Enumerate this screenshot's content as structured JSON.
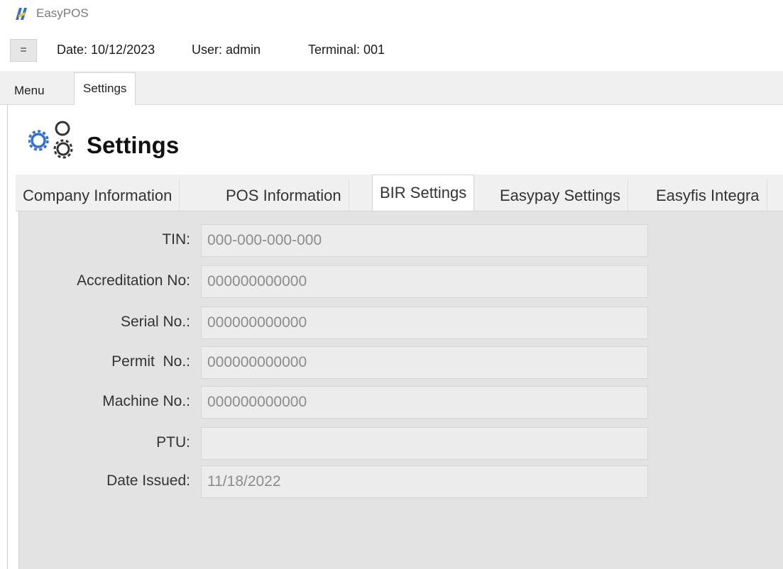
{
  "window": {
    "title": "EasyPOS"
  },
  "status_bar": {
    "menu_toggle_label": "=",
    "date": "Date: 10/12/2023",
    "user": "User: admin",
    "terminal": "Terminal: 001"
  },
  "main_tabs": [
    {
      "label": "Menu"
    },
    {
      "label": "Settings"
    }
  ],
  "page": {
    "title": "Settings",
    "icon": "gears-icon"
  },
  "settings_tabs": [
    {
      "label": "Company Information"
    },
    {
      "label": "POS Information"
    },
    {
      "label": "BIR Settings"
    },
    {
      "label": "Easypay Settings"
    },
    {
      "label": "Easyfis Integra"
    }
  ],
  "active_settings_tab": "BIR Settings",
  "bir_form": {
    "fields": [
      {
        "label": "TIN:",
        "value": "000-000-000-000"
      },
      {
        "label": "Accreditation No:",
        "value": "000000000000"
      },
      {
        "label": "Serial No.:",
        "value": "000000000000"
      },
      {
        "label": "Permit  No.:",
        "value": "000000000000"
      },
      {
        "label": "Machine No.:",
        "value": "000000000000"
      },
      {
        "label": "PTU:",
        "value": ""
      },
      {
        "label": "Date Issued:",
        "value": "11/18/2022"
      }
    ]
  },
  "colors": {
    "panel_background": "#e3e3e3",
    "tabstrip_background": "#f0f0f0",
    "field_text": "#8c8c8c",
    "logo_blue": "#2f6fdb",
    "logo_yellow": "#f2c12e"
  }
}
